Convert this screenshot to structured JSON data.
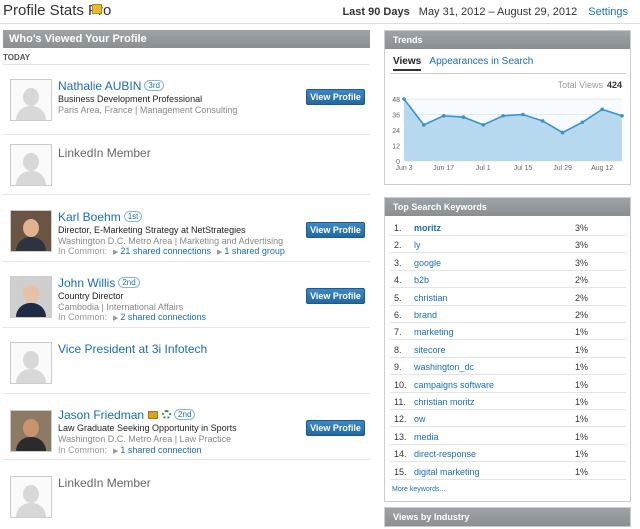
{
  "header": {
    "title": "Profile Stats Pro",
    "period_label": "Last 90 Days",
    "date_range": "May 31, 2012 – August 29, 2012",
    "settings_label": "Settings"
  },
  "viewers": {
    "section_title": "Who's Viewed Your Profile",
    "today_label": "TODAY",
    "view_profile_label": "View Profile",
    "in_common_label": "In Common:",
    "items": [
      {
        "name": "Nathalie AUBIN",
        "degree": "3rd",
        "title": "Business Development Professional",
        "location": "Paris Area, France | Management Consulting"
      },
      {
        "name": "LinkedIn Member"
      },
      {
        "name": "Karl Boehm",
        "degree": "1st",
        "title": "Director, E-Marketing Strategy at NetStrategies",
        "location": "Washington D.C. Metro Area | Marketing and Advertising",
        "common_1": "21 shared connections",
        "common_2": "1 shared group"
      },
      {
        "name": "John Willis",
        "degree": "2nd",
        "title": "Country Director",
        "location": "Cambodia | International Affairs",
        "common_1": "2 shared connections"
      },
      {
        "name": "Vice President at 3i Infotech"
      },
      {
        "name": "Jason Friedman",
        "degree": "2nd",
        "title": "Law Graduate Seeking Opportunity in Sports",
        "location": "Washington D.C. Metro Area | Law Practice",
        "common_1": "1 shared connection"
      },
      {
        "name": "LinkedIn Member"
      }
    ]
  },
  "trends": {
    "section_title": "Trends",
    "tab_views": "Views",
    "tab_search": "Appearances in Search",
    "total_label": "Total Views",
    "total_value": "424"
  },
  "chart_data": {
    "type": "area",
    "x_tick_labels": [
      "Jun 3",
      "Jun 17",
      "Jul 1",
      "Jul 15",
      "Jul 29",
      "Aug 12"
    ],
    "y_tick_labels": [
      "0",
      "12",
      "24",
      "36",
      "48"
    ],
    "ylim": [
      0,
      48
    ],
    "values": [
      48,
      28,
      35,
      34,
      28,
      35,
      36,
      31,
      22,
      30,
      40,
      35
    ],
    "colors": {
      "line": "#3b93c9",
      "fill": "#b7d9ef"
    }
  },
  "keywords": {
    "section_title": "Top Search Keywords",
    "more_label": "More keywords...",
    "items": [
      {
        "rank": "1.",
        "term": "moritz",
        "pct": "3%"
      },
      {
        "rank": "2.",
        "term": "ly",
        "pct": "3%"
      },
      {
        "rank": "3.",
        "term": "google",
        "pct": "3%"
      },
      {
        "rank": "4.",
        "term": "b2b",
        "pct": "2%"
      },
      {
        "rank": "5.",
        "term": "christian",
        "pct": "2%"
      },
      {
        "rank": "6.",
        "term": "brand",
        "pct": "2%"
      },
      {
        "rank": "7.",
        "term": "marketing",
        "pct": "1%"
      },
      {
        "rank": "8.",
        "term": "sitecore",
        "pct": "1%"
      },
      {
        "rank": "9.",
        "term": "washington_dc",
        "pct": "1%"
      },
      {
        "rank": "10.",
        "term": "campaigns software",
        "pct": "1%"
      },
      {
        "rank": "11.",
        "term": "christian moritz",
        "pct": "1%"
      },
      {
        "rank": "12.",
        "term": "ow",
        "pct": "1%"
      },
      {
        "rank": "13.",
        "term": "media",
        "pct": "1%"
      },
      {
        "rank": "14.",
        "term": "direct-response",
        "pct": "1%"
      },
      {
        "rank": "15.",
        "term": "digital marketing",
        "pct": "1%"
      }
    ]
  },
  "industry": {
    "section_title": "Views by Industry"
  }
}
